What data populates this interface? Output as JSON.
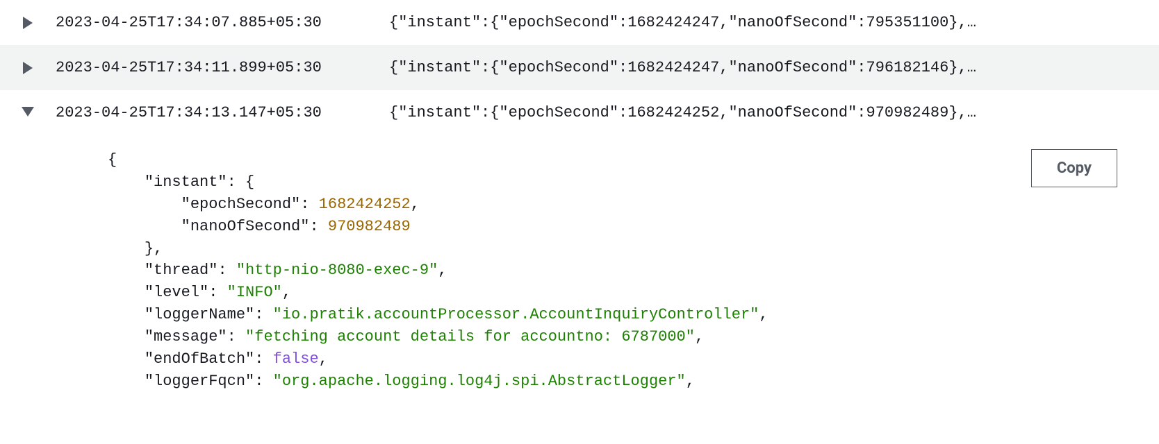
{
  "logs": [
    {
      "timestamp": "2023-04-25T17:34:07.885+05:30",
      "summary": "{\"instant\":{\"epochSecond\":1682424247,\"nanoOfSecond\":795351100},…",
      "expanded": false
    },
    {
      "timestamp": "2023-04-25T17:34:11.899+05:30",
      "summary": "{\"instant\":{\"epochSecond\":1682424247,\"nanoOfSecond\":796182146},…",
      "expanded": false
    },
    {
      "timestamp": "2023-04-25T17:34:13.147+05:30",
      "summary": "{\"instant\":{\"epochSecond\":1682424252,\"nanoOfSecond\":970982489},…",
      "expanded": true
    }
  ],
  "copy_label": "Copy",
  "json_detail": {
    "keys": {
      "instant": "\"instant\"",
      "epochSecond": "\"epochSecond\"",
      "nanoOfSecond": "\"nanoOfSecond\"",
      "thread": "\"thread\"",
      "level": "\"level\"",
      "loggerName": "\"loggerName\"",
      "message": "\"message\"",
      "endOfBatch": "\"endOfBatch\"",
      "loggerFqcn": "\"loggerFqcn\""
    },
    "values": {
      "epochSecond": "1682424252",
      "nanoOfSecond": "970982489",
      "thread": "\"http-nio-8080-exec-9\"",
      "level": "\"INFO\"",
      "loggerName": "\"io.pratik.accountProcessor.AccountInquiryController\"",
      "message": "\"fetching account details for accountno: 6787000\"",
      "endOfBatch": "false",
      "loggerFqcn": "\"org.apache.logging.log4j.spi.AbstractLogger\""
    },
    "punct": {
      "open_brace": "{",
      "close_brace": "}",
      "open_brace_colon": ": {",
      "colon_space": ": ",
      "comma": ",",
      "close_brace_comma": "},"
    }
  }
}
